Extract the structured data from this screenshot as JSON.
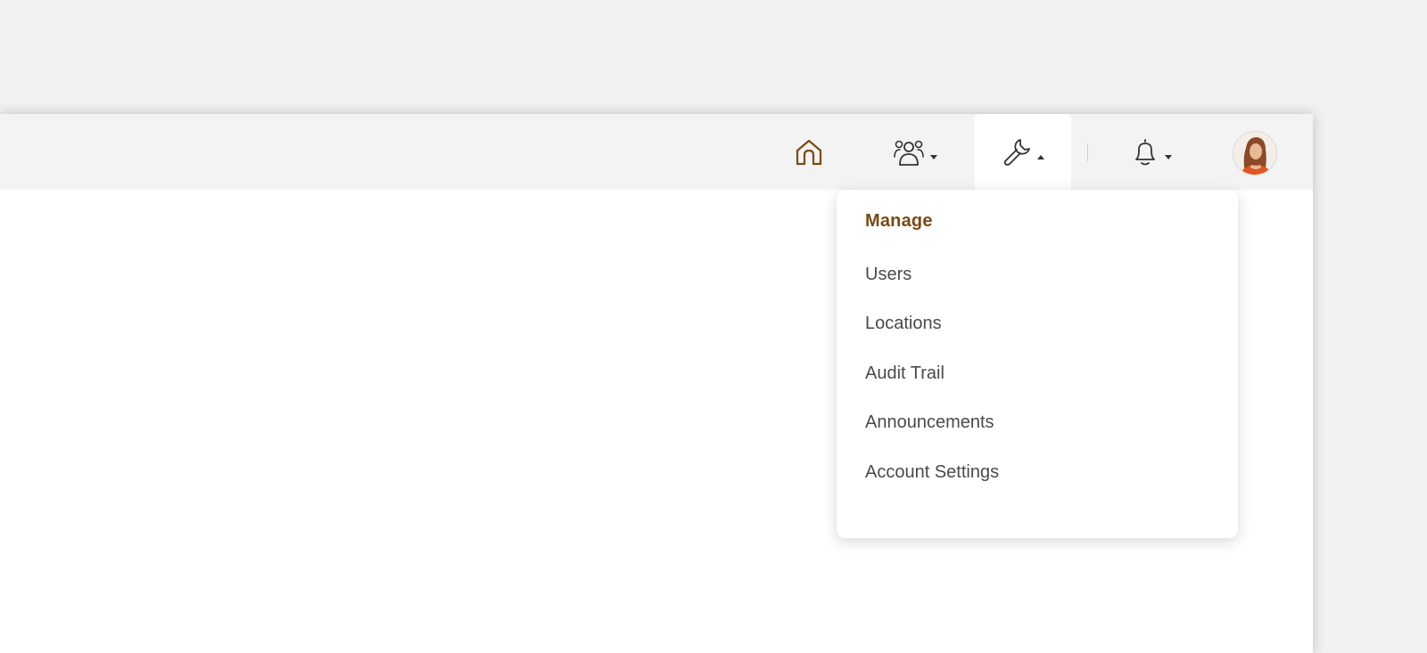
{
  "colors": {
    "accent": "#7a4a12",
    "page_background": "#f2f2f2",
    "top_bar": "#f3f3f3",
    "menu_text": "#4a4a4a"
  },
  "nav": {
    "items": [
      {
        "icon": "home-icon"
      },
      {
        "icon": "users-icon",
        "has_dropdown": true
      },
      {
        "icon": "wrench-icon",
        "has_dropdown": true,
        "active": true
      },
      {
        "icon": "bell-icon",
        "has_dropdown": true
      }
    ],
    "avatar_icon": "user-avatar"
  },
  "manage_menu": {
    "header": "Manage",
    "items": [
      {
        "label": "Users"
      },
      {
        "label": "Locations"
      },
      {
        "label": "Audit Trail"
      },
      {
        "label": "Announcements"
      },
      {
        "label": "Account Settings"
      }
    ]
  }
}
